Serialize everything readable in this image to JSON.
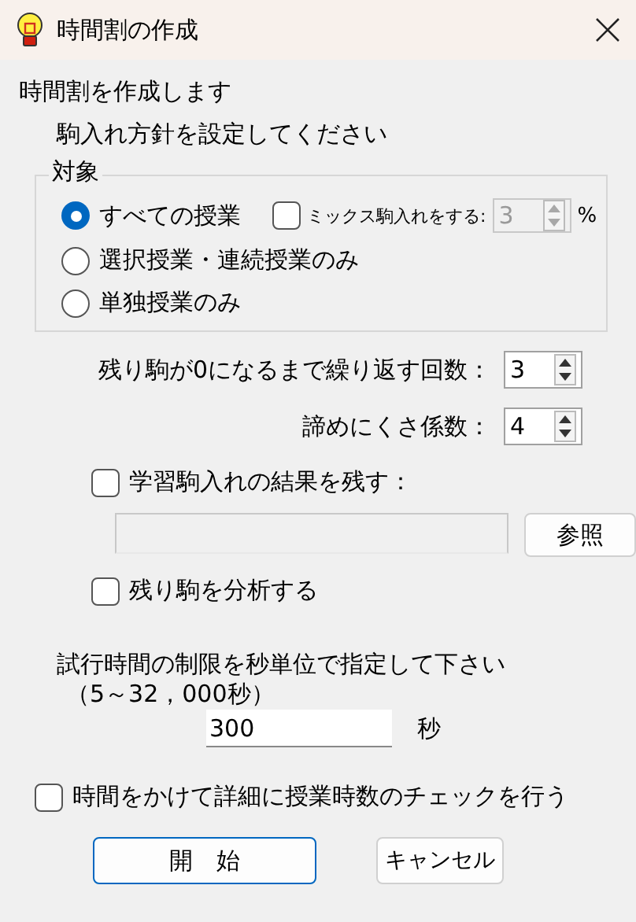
{
  "window": {
    "title": "時間割の作成"
  },
  "intro": "時間割を作成します",
  "instruction": "駒入れ方針を設定してください",
  "target_group": {
    "legend": "対象",
    "options": [
      {
        "label": "すべての授業",
        "selected": true
      },
      {
        "label": "選択授業・連続授業のみ",
        "selected": false
      },
      {
        "label": "単独授業のみ",
        "selected": false
      }
    ],
    "mix": {
      "label": "ミックス駒入れをする:",
      "checked": false,
      "value": "3",
      "unit": "%",
      "disabled": true
    }
  },
  "spinners": [
    {
      "label": "残り駒が0になるまで繰り返す回数：",
      "value": "3"
    },
    {
      "label": "諦めにくさ係数：",
      "value": "4"
    }
  ],
  "save_learning": {
    "label": "学習駒入れの結果を残す：",
    "checked": false,
    "path_disabled": true,
    "browse": "参照"
  },
  "analyze": {
    "label": "残り駒を分析する",
    "checked": false
  },
  "time_limit": {
    "label": "試行時間の制限を秒単位で指定して下さい",
    "range": "（5～32，000秒）",
    "value": "300",
    "unit": "秒"
  },
  "detailed_check": {
    "label": "時間をかけて詳細に授業時数のチェックを行う",
    "checked": false
  },
  "buttons": [
    {
      "label": "開　始",
      "kind": "primary"
    },
    {
      "label": "キャンセル",
      "kind": "normal"
    }
  ]
}
